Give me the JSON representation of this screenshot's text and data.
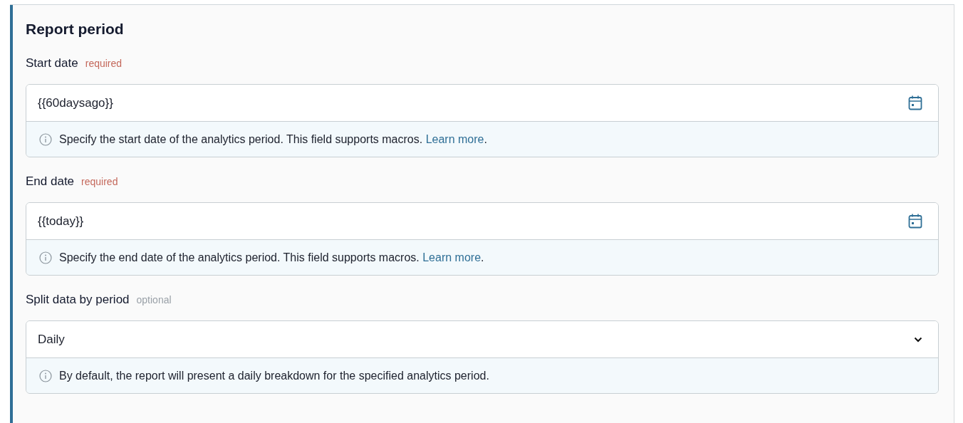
{
  "section": {
    "title": "Report period"
  },
  "fields": [
    {
      "kind": "date",
      "label": "Start date",
      "tag": "required",
      "required": true,
      "value": "{{60daysago}}",
      "help": {
        "text": "Specify the start date of the analytics period. This field supports macros.",
        "link": "Learn more",
        "after": "."
      }
    },
    {
      "kind": "date",
      "label": "End date",
      "tag": "required",
      "required": true,
      "value": "{{today}}",
      "help": {
        "text": "Specify the end date of the analytics period. This field supports macros.",
        "link": "Learn more",
        "after": "."
      }
    },
    {
      "kind": "select",
      "label": "Split data by period",
      "tag": "optional",
      "required": false,
      "value": "Daily",
      "help": {
        "text": "By default, the report will present a daily breakdown for the specified analytics period."
      }
    }
  ]
}
